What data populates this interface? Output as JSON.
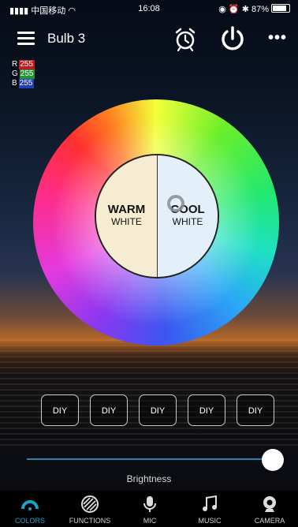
{
  "status_bar": {
    "carrier": "中国移动",
    "time": "16:08",
    "battery": "87%"
  },
  "header": {
    "title": "Bulb 3"
  },
  "rgb": {
    "r_label": "R",
    "r_value": "255",
    "g_label": "G",
    "g_value": "255",
    "b_label": "B",
    "b_value": "255"
  },
  "white_picker": {
    "warm_top": "WARM",
    "warm_bottom": "WHITE",
    "cool_top": "COOL",
    "cool_bottom": "WHITE"
  },
  "diy_buttons": [
    "DIY",
    "DIY",
    "DIY",
    "DIY",
    "DIY"
  ],
  "brightness": {
    "label": "Brightness",
    "level_fraction": 1.0
  },
  "tabs": [
    {
      "label": "COLORS",
      "icon": "colors-icon",
      "active": true
    },
    {
      "label": "FUNCTIONS",
      "icon": "functions-icon",
      "active": false
    },
    {
      "label": "MIC",
      "icon": "mic-icon",
      "active": false
    },
    {
      "label": "MUSIC",
      "icon": "music-icon",
      "active": false
    },
    {
      "label": "CAMERA",
      "icon": "camera-icon",
      "active": false
    }
  ],
  "colors": {
    "accent": "#1fa2c9",
    "warm_white": "#f6ecd2",
    "cool_white": "#e4f0f9"
  }
}
